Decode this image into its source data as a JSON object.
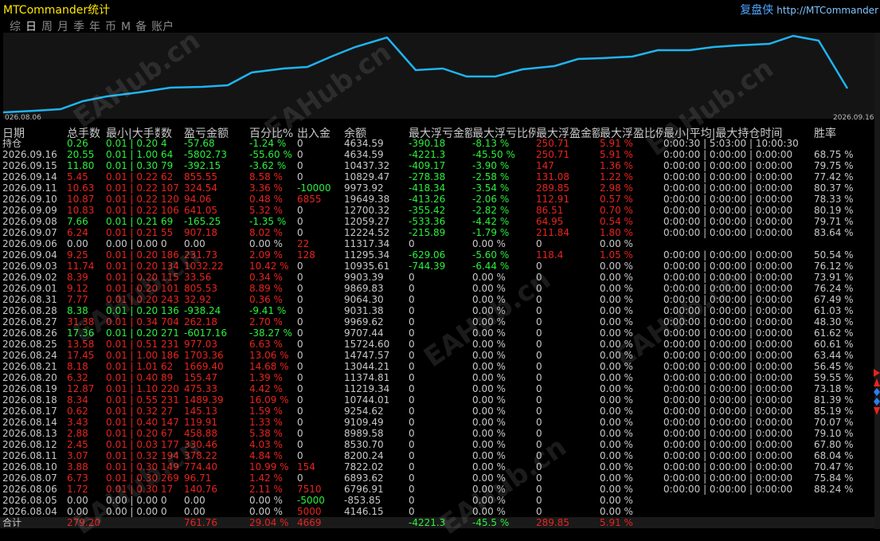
{
  "app_title": "MTCommander统计",
  "header_right": {
    "replay": "复盘侠",
    "url": "http://MTCommander"
  },
  "tabs": [
    "综",
    "日",
    "周",
    "月",
    "季",
    "年",
    "币",
    "M",
    "备",
    "账户"
  ],
  "active_tab": 1,
  "chart": {
    "start_date": "026.08.06",
    "end_date": "2026.09.16",
    "line_color": "#1fb4f0"
  },
  "columns": [
    "日期",
    "总手数",
    "最小|大手数",
    "数",
    "盈亏金额",
    "百分比%",
    "出入金",
    "余额",
    "最大浮亏金额",
    "最大浮亏比例",
    "最大浮盈金额",
    "最大浮盈比例",
    "最小|平均|最大持仓时间",
    "胜率"
  ],
  "rows": [
    [
      "持仓",
      "0.26",
      "0.01 | 0.20",
      "4",
      "-57.68",
      "-1.24 %",
      "0",
      "4634.59",
      "-390.18",
      "-8.13 %",
      "250.71",
      "5.91 %",
      "0:00:30 | 5:03:00 | 10:00:30",
      ""
    ],
    [
      "2026.09.16",
      "20.55",
      "0.01 | 1.00",
      "64",
      "-5802.73",
      "-55.60 %",
      "0",
      "4634.59",
      "-4221.3",
      "-45.50 %",
      "250.71",
      "5.91 %",
      "0:00:00 | 0:00:00 | 0:00:00",
      "68.75 %"
    ],
    [
      "2026.09.15",
      "11.80",
      "0.01 | 0.30",
      "79",
      "-392.15",
      "-3.62 %",
      "0",
      "10437.32",
      "-409.17",
      "-3.90 %",
      "147",
      "1.36 %",
      "0:00:00 | 0:00:00 | 0:00:00",
      "79.75 %"
    ],
    [
      "2026.09.14",
      "5.45",
      "0.01 | 0.22",
      "62",
      "855.55",
      "8.58 %",
      "0",
      "10829.47",
      "-278.38",
      "-2.58 %",
      "131.08",
      "1.22 %",
      "0:00:00 | 0:00:00 | 0:00:00",
      "77.42 %"
    ],
    [
      "2026.09.11",
      "10.63",
      "0.01 | 0.22",
      "107",
      "324.54",
      "3.36 %",
      "-10000",
      "9973.92",
      "-418.34",
      "-3.54 %",
      "289.85",
      "2.98 %",
      "0:00:00 | 0:00:00 | 0:00:00",
      "80.37 %"
    ],
    [
      "2026.09.10",
      "10.87",
      "0.01 | 0.22",
      "120",
      "94.06",
      "0.48 %",
      "6855",
      "19649.38",
      "-413.26",
      "-2.06 %",
      "112.91",
      "0.57 %",
      "0:00:00 | 0:00:00 | 0:00:00",
      "78.33 %"
    ],
    [
      "2026.09.09",
      "10.83",
      "0.01 | 0.22",
      "106",
      "641.05",
      "5.32 %",
      "0",
      "12700.32",
      "-355.42",
      "-2.82 %",
      "86.51",
      "0.70 %",
      "0:00:00 | 0:00:00 | 0:00:00",
      "80.19 %"
    ],
    [
      "2026.09.08",
      "7.66",
      "0.01 | 0.21",
      "69",
      "-165.25",
      "-1.35 %",
      "0",
      "12059.27",
      "-533.36",
      "-4.42 %",
      "64.95",
      "0.54 %",
      "0:00:00 | 0:00:00 | 0:00:00",
      "79.71 %"
    ],
    [
      "2026.09.07",
      "6.24",
      "0.01 | 0.21",
      "55",
      "907.18",
      "8.02 %",
      "0",
      "12224.52",
      "-215.89",
      "-1.79 %",
      "211.84",
      "1.80 %",
      "0:00:00 | 0:00:00 | 0:00:00",
      "83.64 %"
    ],
    [
      "2026.09.06",
      "0.00",
      "0.00 | 0.00",
      "0",
      "0.00",
      "0.00 %",
      "22",
      "11317.34",
      "0",
      "0.00 %",
      "0",
      "0.00 %",
      "",
      ""
    ],
    [
      "2026.09.04",
      "9.25",
      "0.01 | 0.20",
      "186",
      "231.73",
      "2.09 %",
      "128",
      "11295.34",
      "-629.06",
      "-5.60 %",
      "118.4",
      "1.05 %",
      "0:00:00 | 0:00:00 | 0:00:00",
      "50.54 %"
    ],
    [
      "2026.09.03",
      "11.74",
      "0.01 | 0.20",
      "134",
      "1032.22",
      "10.42 %",
      "0",
      "10935.61",
      "-744.39",
      "-6.44 %",
      "0",
      "0.00 %",
      "0:00:00 | 0:00:00 | 0:00:00",
      "76.12 %"
    ],
    [
      "2026.09.02",
      "8.39",
      "0.01 | 0.20",
      "115",
      "33.56",
      "0.34 %",
      "0",
      "9903.39",
      "0",
      "0.00 %",
      "0",
      "0.00 %",
      "0:00:00 | 0:00:00 | 0:00:00",
      "73.91 %"
    ],
    [
      "2026.09.01",
      "9.12",
      "0.01 | 0.20",
      "101",
      "805.53",
      "8.89 %",
      "0",
      "9869.83",
      "0",
      "0.00 %",
      "0",
      "0.00 %",
      "0:00:00 | 0:00:00 | 0:00:00",
      "76.24 %"
    ],
    [
      "2026.08.31",
      "7.77",
      "0.01 | 0.20",
      "243",
      "32.92",
      "0.36 %",
      "0",
      "9064.30",
      "0",
      "0.00 %",
      "0",
      "0.00 %",
      "0:00:00 | 0:00:00 | 0:00:00",
      "67.49 %"
    ],
    [
      "2026.08.28",
      "8.38",
      "0.01 | 0.20",
      "136",
      "-938.24",
      "-9.41 %",
      "0",
      "9031.38",
      "0",
      "0.00 %",
      "0",
      "0.00 %",
      "0:00:00 | 0:00:00 | 0:00:00",
      "61.03 %"
    ],
    [
      "2026.08.27",
      "31.38",
      "0.01 | 0.34",
      "704",
      "262.18",
      "2.70 %",
      "0",
      "9969.62",
      "0",
      "0.00 %",
      "0",
      "0.00 %",
      "0:00:00 | 0:00:00 | 0:00:00",
      "48.30 %"
    ],
    [
      "2026.08.26",
      "17.36",
      "0.01 | 0.20",
      "271",
      "-6017.16",
      "-38.27 %",
      "0",
      "9707.44",
      "0",
      "0.00 %",
      "0",
      "0.00 %",
      "0:00:00 | 0:00:00 | 0:00:00",
      "61.62 %"
    ],
    [
      "2026.08.25",
      "13.58",
      "0.01 | 0.51",
      "231",
      "977.03",
      "6.63 %",
      "0",
      "15724.60",
      "0",
      "0.00 %",
      "0",
      "0.00 %",
      "0:00:00 | 0:00:00 | 0:00:00",
      "60.61 %"
    ],
    [
      "2026.08.24",
      "17.45",
      "0.01 | 1.00",
      "186",
      "1703.36",
      "13.06 %",
      "0",
      "14747.57",
      "0",
      "0.00 %",
      "0",
      "0.00 %",
      "0:00:00 | 0:00:00 | 0:00:00",
      "63.44 %"
    ],
    [
      "2026.08.21",
      "8.18",
      "0.01 | 1.01",
      "62",
      "1669.40",
      "14.68 %",
      "0",
      "13044.21",
      "0",
      "0.00 %",
      "0",
      "0.00 %",
      "0:00:00 | 0:00:00 | 0:00:00",
      "56.45 %"
    ],
    [
      "2026.08.20",
      "6.32",
      "0.01 | 0.40",
      "89",
      "155.47",
      "1.39 %",
      "0",
      "11374.81",
      "0",
      "0.00 %",
      "0",
      "0.00 %",
      "0:00:00 | 0:00:00 | 0:00:00",
      "59.55 %"
    ],
    [
      "2026.08.19",
      "12.87",
      "0.01 | 1.10",
      "220",
      "475.33",
      "4.42 %",
      "0",
      "11219.34",
      "0",
      "0.00 %",
      "0",
      "0.00 %",
      "0:00:00 | 0:00:00 | 0:00:00",
      "73.18 %"
    ],
    [
      "2026.08.18",
      "8.34",
      "0.01 | 0.55",
      "231",
      "1489.39",
      "16.09 %",
      "0",
      "10744.01",
      "0",
      "0.00 %",
      "0",
      "0.00 %",
      "0:00:00 | 0:00:00 | 0:00:00",
      "81.39 %"
    ],
    [
      "2026.08.17",
      "0.62",
      "0.01 | 0.32",
      "27",
      "145.13",
      "1.59 %",
      "0",
      "9254.62",
      "0",
      "0.00 %",
      "0",
      "0.00 %",
      "0:00:00 | 0:00:00 | 0:00:00",
      "85.19 %"
    ],
    [
      "2026.08.14",
      "3.43",
      "0.01 | 0.40",
      "147",
      "119.91",
      "1.33 %",
      "0",
      "9109.49",
      "0",
      "0.00 %",
      "0",
      "0.00 %",
      "0:00:00 | 0:00:00 | 0:00:00",
      "70.07 %"
    ],
    [
      "2026.08.13",
      "2.88",
      "0.01 | 0.20",
      "67",
      "458.88",
      "5.38 %",
      "0",
      "8989.58",
      "0",
      "0.00 %",
      "0",
      "0.00 %",
      "0:00:00 | 0:00:00 | 0:00:00",
      "79.10 %"
    ],
    [
      "2026.08.12",
      "2.45",
      "0.01 | 0.03",
      "177",
      "330.46",
      "4.03 %",
      "0",
      "8530.70",
      "0",
      "0.00 %",
      "0",
      "0.00 %",
      "0:00:00 | 0:00:00 | 0:00:00",
      "67.80 %"
    ],
    [
      "2026.08.11",
      "3.07",
      "0.01 | 0.32",
      "194",
      "378.22",
      "4.84 %",
      "0",
      "8200.24",
      "0",
      "0.00 %",
      "0",
      "0.00 %",
      "0:00:00 | 0:00:00 | 0:00:00",
      "68.04 %"
    ],
    [
      "2026.08.10",
      "3.88",
      "0.01 | 0.30",
      "149",
      "774.40",
      "10.99 %",
      "154",
      "7822.02",
      "0",
      "0.00 %",
      "0",
      "0.00 %",
      "0:00:00 | 0:00:00 | 0:00:00",
      "70.47 %"
    ],
    [
      "2026.08.07",
      "6.73",
      "0.01 | 0.30",
      "269",
      "96.71",
      "1.42 %",
      "0",
      "6893.62",
      "0",
      "0.00 %",
      "0",
      "0.00 %",
      "0:00:00 | 0:00:00 | 0:00:00",
      "75.84 %"
    ],
    [
      "2026.08.06",
      "1.72",
      "0.01 | 0.30",
      "17",
      "140.76",
      "2.11 %",
      "7510",
      "6796.91",
      "0",
      "0.00 %",
      "0",
      "0.00 %",
      "0:00:00 | 0:00:00 | 0:00:00",
      "88.24 %"
    ],
    [
      "2026.08.05",
      "0.00",
      "0.00 | 0.00",
      "0",
      "0.00",
      "0.00 %",
      "-5000",
      "-853.85",
      "0",
      "0.00 %",
      "0",
      "0.00 %",
      "",
      ""
    ],
    [
      "2026.08.04",
      "0.00",
      "0.00 | 0.00",
      "0",
      "0.00",
      "0.00 %",
      "5000",
      "4146.15",
      "0",
      "0.00 %",
      "0",
      "0.00 %",
      "",
      ""
    ],
    [
      "合计",
      "279.20",
      "",
      "",
      "761.76",
      "29.04 %",
      "4669",
      "",
      "-4221.3",
      "-45.5 %",
      "289.85",
      "5.91 %",
      "",
      ""
    ]
  ],
  "colors": {
    "positive": "#e8231e",
    "negative": "#2bef3c",
    "neutral": "#c8c8c8",
    "header": "#c8c8c8",
    "date": "#c8c8c8"
  },
  "watermark": "EAHub.cn"
}
